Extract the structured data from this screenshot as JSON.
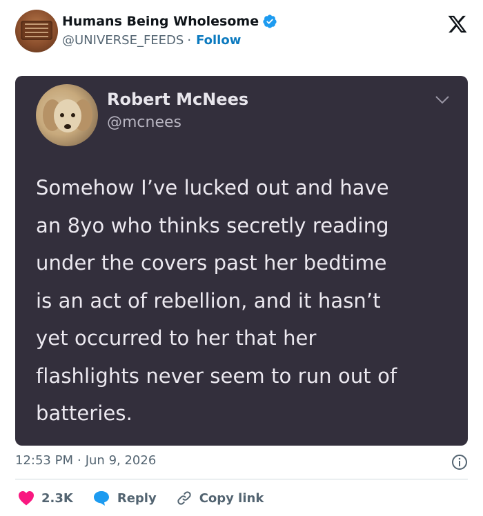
{
  "header": {
    "account_name": "Humans Being Wholesome",
    "handle": "@UNIVERSE_FEEDS",
    "separator": "·",
    "follow_label": "Follow"
  },
  "tweet_card": {
    "author_name": "Robert McNees",
    "author_handle": "@mcnees",
    "body_lines": [
      "Somehow I’ve lucked out and have",
      "an 8yo who thinks secretly reading",
      "under the covers past her bedtime",
      "is an act of rebellion, and it hasn’t",
      "yet occurred to her that her",
      "flashlights never seem to run out of",
      "batteries."
    ]
  },
  "meta": {
    "time": "12:53 PM",
    "separator": "·",
    "date": "Jun 9, 2026"
  },
  "actions": {
    "likes_count": "2.3K",
    "reply_label": "Reply",
    "copy_link_label": "Copy link"
  },
  "colors": {
    "card_background": "#332f3c",
    "link_blue": "#0c7abf",
    "like_red": "#f91880",
    "reply_blue": "#1d9bf0",
    "verified_blue": "#1d9bf0"
  },
  "icons": [
    "verified-badge-icon",
    "x-logo-icon",
    "chevron-down-icon",
    "info-icon",
    "heart-icon",
    "reply-bubble-icon",
    "link-icon"
  ]
}
